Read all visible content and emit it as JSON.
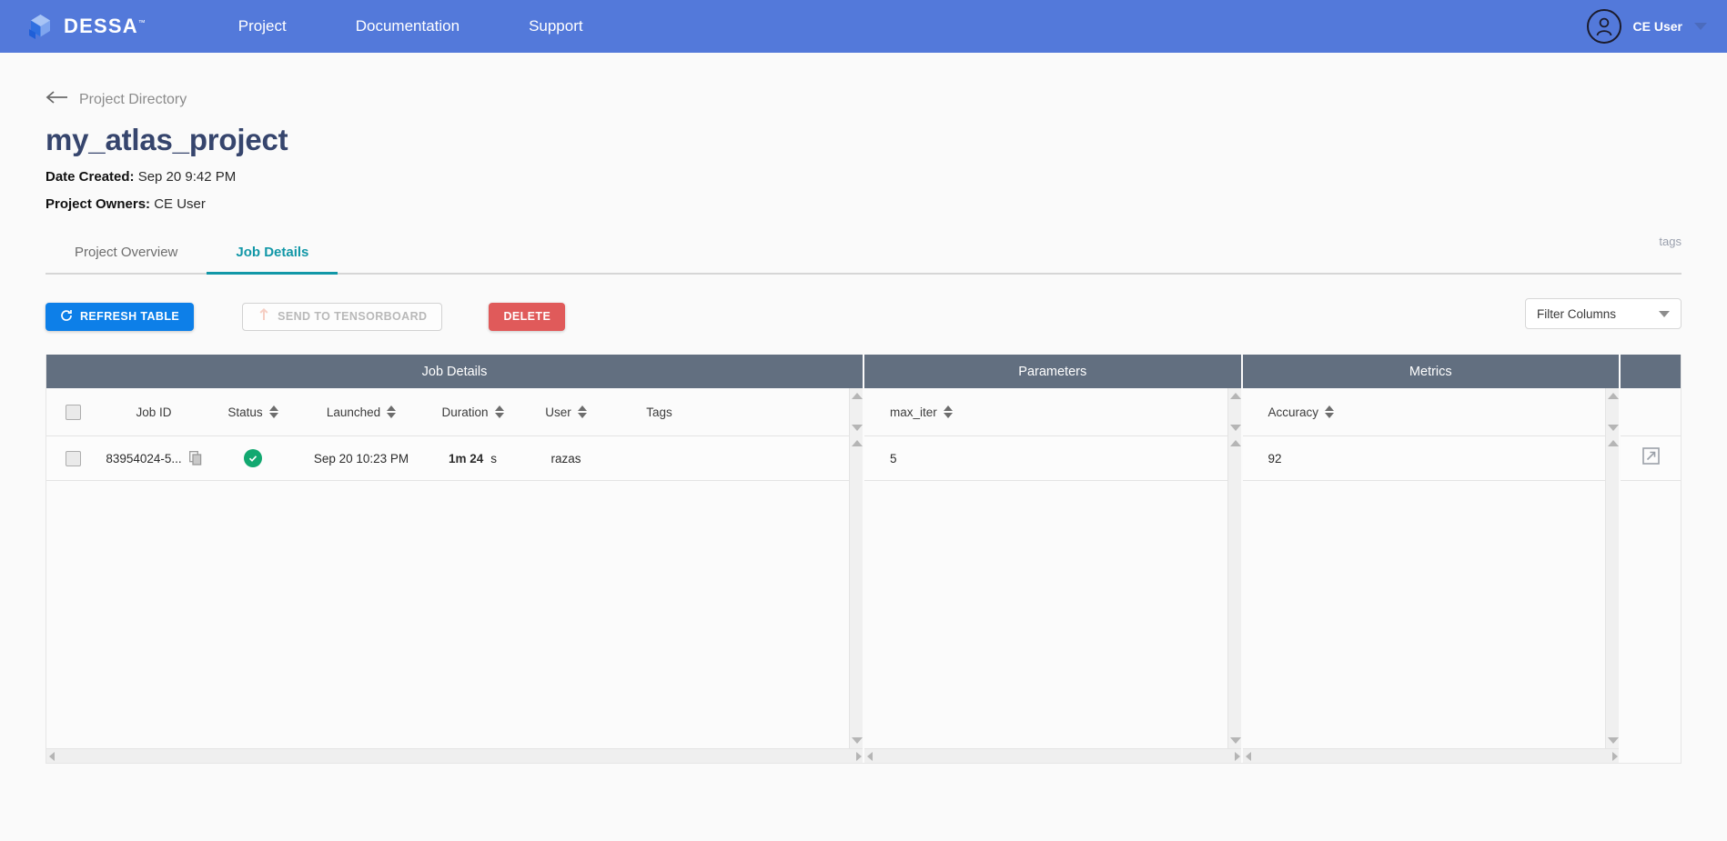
{
  "topnav": {
    "brand": "DESSA",
    "brand_tm": "™",
    "links": [
      {
        "label": "Project"
      },
      {
        "label": "Documentation"
      },
      {
        "label": "Support"
      }
    ],
    "user": {
      "name": "CE User"
    },
    "bg_color": "#5379da"
  },
  "breadcrumb": {
    "label": "Project Directory"
  },
  "project": {
    "title": "my_atlas_project",
    "tags_label": "tags",
    "date_created_key": "Date Created:",
    "date_created_val": "Sep 20 9:42 PM",
    "owners_key": "Project Owners:",
    "owners_val": "CE User"
  },
  "tabs": [
    {
      "label": "Project Overview",
      "active": false
    },
    {
      "label": "Job Details",
      "active": true
    }
  ],
  "actions": {
    "refresh_label": "REFRESH TABLE",
    "tensorboard_label": "SEND TO TENSORBOARD",
    "delete_label": "DELETE",
    "filter_label": "Filter Columns",
    "accent_refresh": "#0d7fe8",
    "accent_delete": "#e05a5a",
    "accent_tab": "#1197a7"
  },
  "table": {
    "groups": [
      {
        "title": "Job Details"
      },
      {
        "title": "Parameters"
      },
      {
        "title": "Metrics"
      },
      {
        "title": ""
      }
    ],
    "job_columns": [
      {
        "label": "Job ID",
        "sortable": false
      },
      {
        "label": "Status",
        "sortable": true
      },
      {
        "label": "Launched",
        "sortable": true
      },
      {
        "label": "Duration",
        "sortable": true
      },
      {
        "label": "User",
        "sortable": true
      },
      {
        "label": "Tags",
        "sortable": false
      }
    ],
    "param_columns": [
      {
        "label": "max_iter",
        "sortable": true
      }
    ],
    "metric_columns": [
      {
        "label": "Accuracy",
        "sortable": true
      }
    ],
    "rows": [
      {
        "job_id": "83954024-5...",
        "status": "success",
        "launched": "Sep 20 10:23 PM",
        "duration_num": "1m 24",
        "duration_unit": "s",
        "user": "razas",
        "tags": "",
        "max_iter": "5",
        "accuracy": "92"
      }
    ]
  }
}
